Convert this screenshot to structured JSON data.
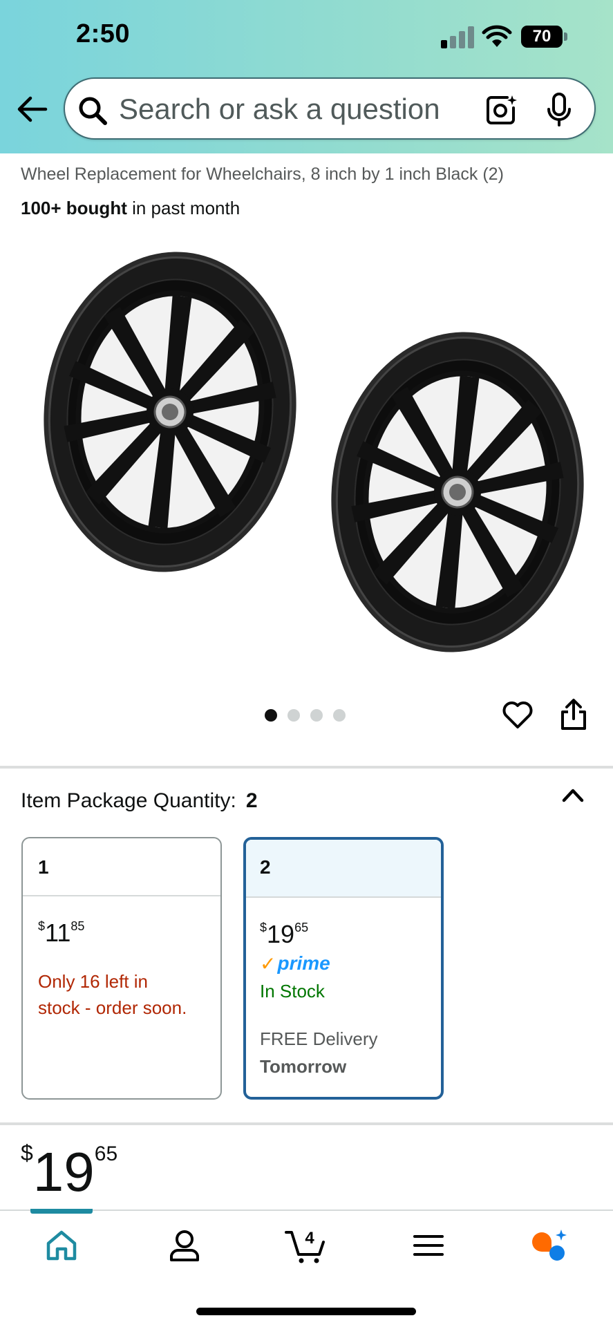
{
  "status_bar": {
    "time": "2:50",
    "battery": "70"
  },
  "search": {
    "placeholder": "Search or ask a question"
  },
  "product": {
    "title": "Wheel Replacement for Wheelchairs, 8 inch by 1 inch Black (2)",
    "bought_count": "100+ bought",
    "bought_suffix": "in past month"
  },
  "gallery": {
    "image_count": 4,
    "active_index": 0
  },
  "package_quantity": {
    "label": "Item Package Quantity:",
    "selected": "2",
    "options": [
      {
        "qty": "1",
        "currency": "$",
        "price_whole": "11",
        "price_cents": "85",
        "stock_warning_line1": "Only 16 left in",
        "stock_warning_line2": "stock - order soon."
      },
      {
        "qty": "2",
        "currency": "$",
        "price_whole": "19",
        "price_cents": "65",
        "prime_check": "✓",
        "prime_text": "prime",
        "stock": "In Stock",
        "delivery_line1": "FREE Delivery",
        "delivery_line2": "Tomorrow"
      }
    ]
  },
  "price": {
    "currency": "$",
    "whole": "19",
    "cents": "65"
  },
  "nav": {
    "cart_count": "4",
    "items": [
      "home-icon",
      "account-icon",
      "cart-icon",
      "menu-icon",
      "rufus-icon"
    ]
  },
  "colors": {
    "accent": "#236198",
    "home_active": "#1e8ba1",
    "warning": "#b12704",
    "in_stock": "#007600",
    "prime_blue": "#1a98ff",
    "prime_check": "#ff9900"
  }
}
